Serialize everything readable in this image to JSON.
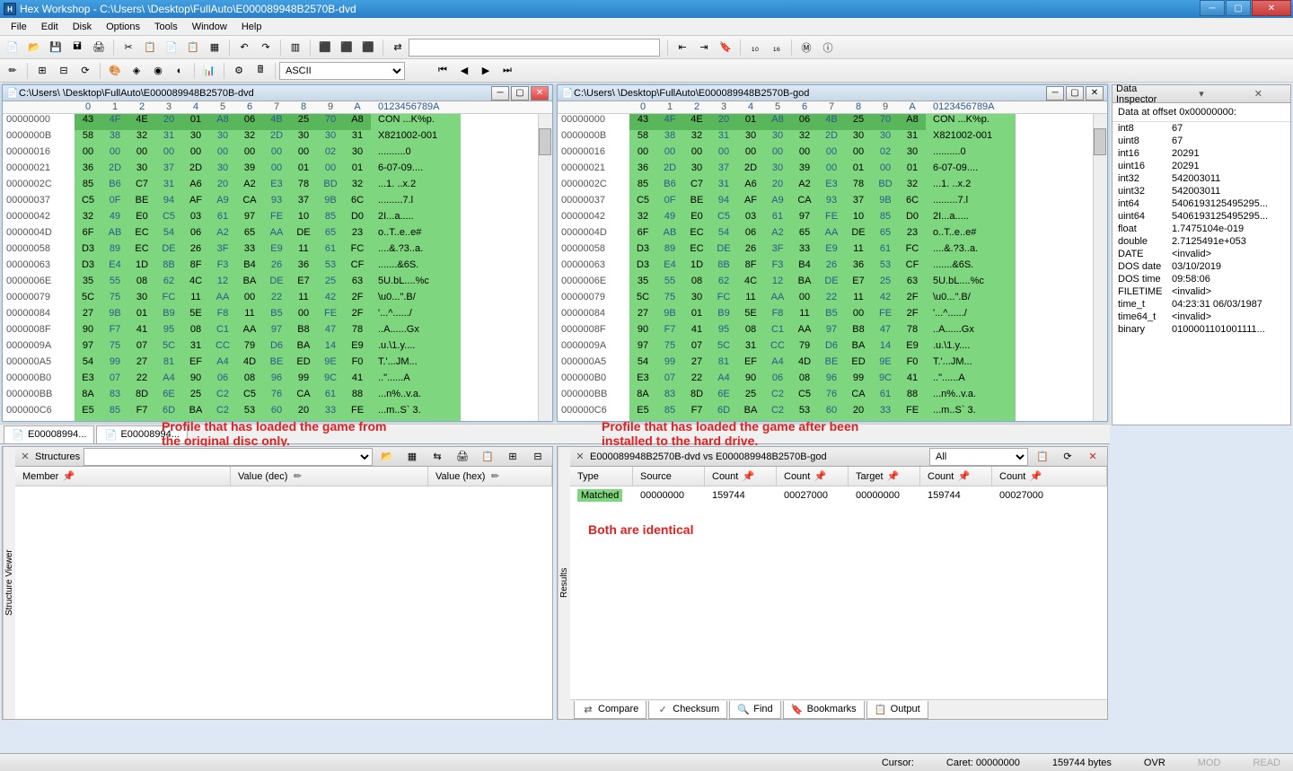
{
  "title": "Hex Workshop - C:\\Users\\      \\Desktop\\FullAuto\\E000089948B2570B-dvd",
  "menu": [
    "File",
    "Edit",
    "Disk",
    "Options",
    "Tools",
    "Window",
    "Help"
  ],
  "toolbars": {
    "ascii_label": "ASCII"
  },
  "windows": {
    "left": {
      "path": "C:\\Users\\       \\Desktop\\FullAuto\\E000089948B2570B-dvd",
      "col_header": [
        "0",
        "1",
        "2",
        "3",
        "4",
        "5",
        "6",
        "7",
        "8",
        "9",
        "A"
      ],
      "ascii_header": "0123456789A"
    },
    "right": {
      "path": "C:\\Users\\       \\Desktop\\FullAuto\\E000089948B2570B-god",
      "col_header": [
        "0",
        "1",
        "2",
        "3",
        "4",
        "5",
        "6",
        "7",
        "8",
        "9",
        "A"
      ],
      "ascii_header": "0123456789A"
    }
  },
  "hex_lines": [
    {
      "addr": "00000000",
      "bytes": [
        "43",
        "4F",
        "4E",
        "20",
        "01",
        "A8",
        "06",
        "4B",
        "25",
        "70",
        "A8"
      ],
      "ascii": "CON ...K%p."
    },
    {
      "addr": "0000000B",
      "bytes": [
        "58",
        "38",
        "32",
        "31",
        "30",
        "30",
        "32",
        "2D",
        "30",
        "30",
        "31"
      ],
      "ascii": "X821002-001"
    },
    {
      "addr": "00000016",
      "bytes": [
        "00",
        "00",
        "00",
        "00",
        "00",
        "00",
        "00",
        "00",
        "00",
        "02",
        "30"
      ],
      "ascii": "..........0"
    },
    {
      "addr": "00000021",
      "bytes": [
        "36",
        "2D",
        "30",
        "37",
        "2D",
        "30",
        "39",
        "00",
        "01",
        "00",
        "01"
      ],
      "ascii": "6-07-09...."
    },
    {
      "addr": "0000002C",
      "bytes": [
        "85",
        "B6",
        "C7",
        "31",
        "A6",
        "20",
        "A2",
        "E3",
        "78",
        "BD",
        "32"
      ],
      "ascii": "...1. ..x.2"
    },
    {
      "addr": "00000037",
      "bytes": [
        "C5",
        "0F",
        "BE",
        "94",
        "AF",
        "A9",
        "CA",
        "93",
        "37",
        "9B",
        "6C"
      ],
      "ascii": ".........7.l"
    },
    {
      "addr": "00000042",
      "bytes": [
        "32",
        "49",
        "E0",
        "C5",
        "03",
        "61",
        "97",
        "FE",
        "10",
        "85",
        "D0"
      ],
      "ascii": "2I...a....."
    },
    {
      "addr": "0000004D",
      "bytes": [
        "6F",
        "AB",
        "EC",
        "54",
        "06",
        "A2",
        "65",
        "AA",
        "DE",
        "65",
        "23"
      ],
      "ascii": "o..T..e..e#"
    },
    {
      "addr": "00000058",
      "bytes": [
        "D3",
        "89",
        "EC",
        "DE",
        "26",
        "3F",
        "33",
        "E9",
        "11",
        "61",
        "FC"
      ],
      "ascii": "....&.?3..a."
    },
    {
      "addr": "00000063",
      "bytes": [
        "D3",
        "E4",
        "1D",
        "8B",
        "8F",
        "F3",
        "B4",
        "26",
        "36",
        "53",
        "CF"
      ],
      "ascii": ".......&6S."
    },
    {
      "addr": "0000006E",
      "bytes": [
        "35",
        "55",
        "08",
        "62",
        "4C",
        "12",
        "BA",
        "DE",
        "E7",
        "25",
        "63"
      ],
      "ascii": "5U.bL....%c"
    },
    {
      "addr": "00000079",
      "bytes": [
        "5C",
        "75",
        "30",
        "FC",
        "11",
        "AA",
        "00",
        "22",
        "11",
        "42",
        "2F"
      ],
      "ascii": "\\u0...\".B/"
    },
    {
      "addr": "00000084",
      "bytes": [
        "27",
        "9B",
        "01",
        "B9",
        "5E",
        "F8",
        "11",
        "B5",
        "00",
        "FE",
        "2F"
      ],
      "ascii": "'...^....../"
    },
    {
      "addr": "0000008F",
      "bytes": [
        "90",
        "F7",
        "41",
        "95",
        "08",
        "C1",
        "AA",
        "97",
        "B8",
        "47",
        "78"
      ],
      "ascii": "..A......Gx"
    },
    {
      "addr": "0000009A",
      "bytes": [
        "97",
        "75",
        "07",
        "5C",
        "31",
        "CC",
        "79",
        "D6",
        "BA",
        "14",
        "E9"
      ],
      "ascii": ".u.\\1.y...."
    },
    {
      "addr": "000000A5",
      "bytes": [
        "54",
        "99",
        "27",
        "81",
        "EF",
        "A4",
        "4D",
        "BE",
        "ED",
        "9E",
        "F0"
      ],
      "ascii": "T.'...JM..."
    },
    {
      "addr": "000000B0",
      "bytes": [
        "E3",
        "07",
        "22",
        "A4",
        "90",
        "06",
        "08",
        "96",
        "99",
        "9C",
        "41"
      ],
      "ascii": "..\"......A"
    },
    {
      "addr": "000000BB",
      "bytes": [
        "8A",
        "83",
        "8D",
        "6E",
        "25",
        "C2",
        "C5",
        "76",
        "CA",
        "61",
        "88"
      ],
      "ascii": "...n%..v.a."
    },
    {
      "addr": "000000C6",
      "bytes": [
        "E5",
        "85",
        "F7",
        "6D",
        "BA",
        "C2",
        "53",
        "60",
        "20",
        "33",
        "FE"
      ],
      "ascii": "...m..S` 3."
    }
  ],
  "inspector": {
    "title": "Data Inspector",
    "header": "Data at offset 0x00000000:",
    "rows": [
      {
        "label": "int8",
        "value": "67"
      },
      {
        "label": "uint8",
        "value": "67"
      },
      {
        "label": "int16",
        "value": "20291"
      },
      {
        "label": "uint16",
        "value": "20291"
      },
      {
        "label": "int32",
        "value": "542003011"
      },
      {
        "label": "uint32",
        "value": "542003011"
      },
      {
        "label": "int64",
        "value": "5406193125495295..."
      },
      {
        "label": "uint64",
        "value": "5406193125495295..."
      },
      {
        "label": "float",
        "value": "1.7475104e-019"
      },
      {
        "label": "double",
        "value": "2.7125491e+053"
      },
      {
        "label": "DATE",
        "value": "<invalid>"
      },
      {
        "label": "DOS date",
        "value": "03/10/2019"
      },
      {
        "label": "DOS time",
        "value": "09:58:06"
      },
      {
        "label": "FILETIME",
        "value": "<invalid>"
      },
      {
        "label": "time_t",
        "value": "04:23:31 06/03/1987"
      },
      {
        "label": "time64_t",
        "value": "<invalid>"
      },
      {
        "label": "binary",
        "value": "0100001101001111..."
      }
    ]
  },
  "tabs": {
    "tab1": "E00008994...",
    "tab2": "E00008994..."
  },
  "annotations": {
    "left": "Profile that has loaded the game from\nthe original disc only.",
    "right": "Profile that has loaded the game after been\ninstalled to the hard drive.",
    "identical": "Both are identical"
  },
  "structures": {
    "title": "Structures",
    "vertical_label": "Structure Viewer",
    "cols": [
      "Member",
      "Value (dec)",
      "Value (hex)"
    ]
  },
  "results": {
    "title": "E000089948B2570B-dvd vs E000089948B2570B-god",
    "vertical_label": "Results",
    "filter": "All",
    "cols": [
      "Type",
      "Source",
      "Count",
      "Count",
      "Target",
      "Count",
      "Count"
    ],
    "row": {
      "type": "Matched",
      "source": "00000000",
      "count1": "159744",
      "count2": "00027000",
      "target": "00000000",
      "count3": "159744",
      "count4": "00027000"
    },
    "tabs": [
      "Compare",
      "Checksum",
      "Find",
      "Bookmarks",
      "Output"
    ]
  },
  "status": {
    "cursor": "Cursor:",
    "caret": "Caret: 00000000",
    "size": "159744 bytes",
    "ovr": "OVR",
    "mod": "MOD",
    "read": "READ"
  }
}
